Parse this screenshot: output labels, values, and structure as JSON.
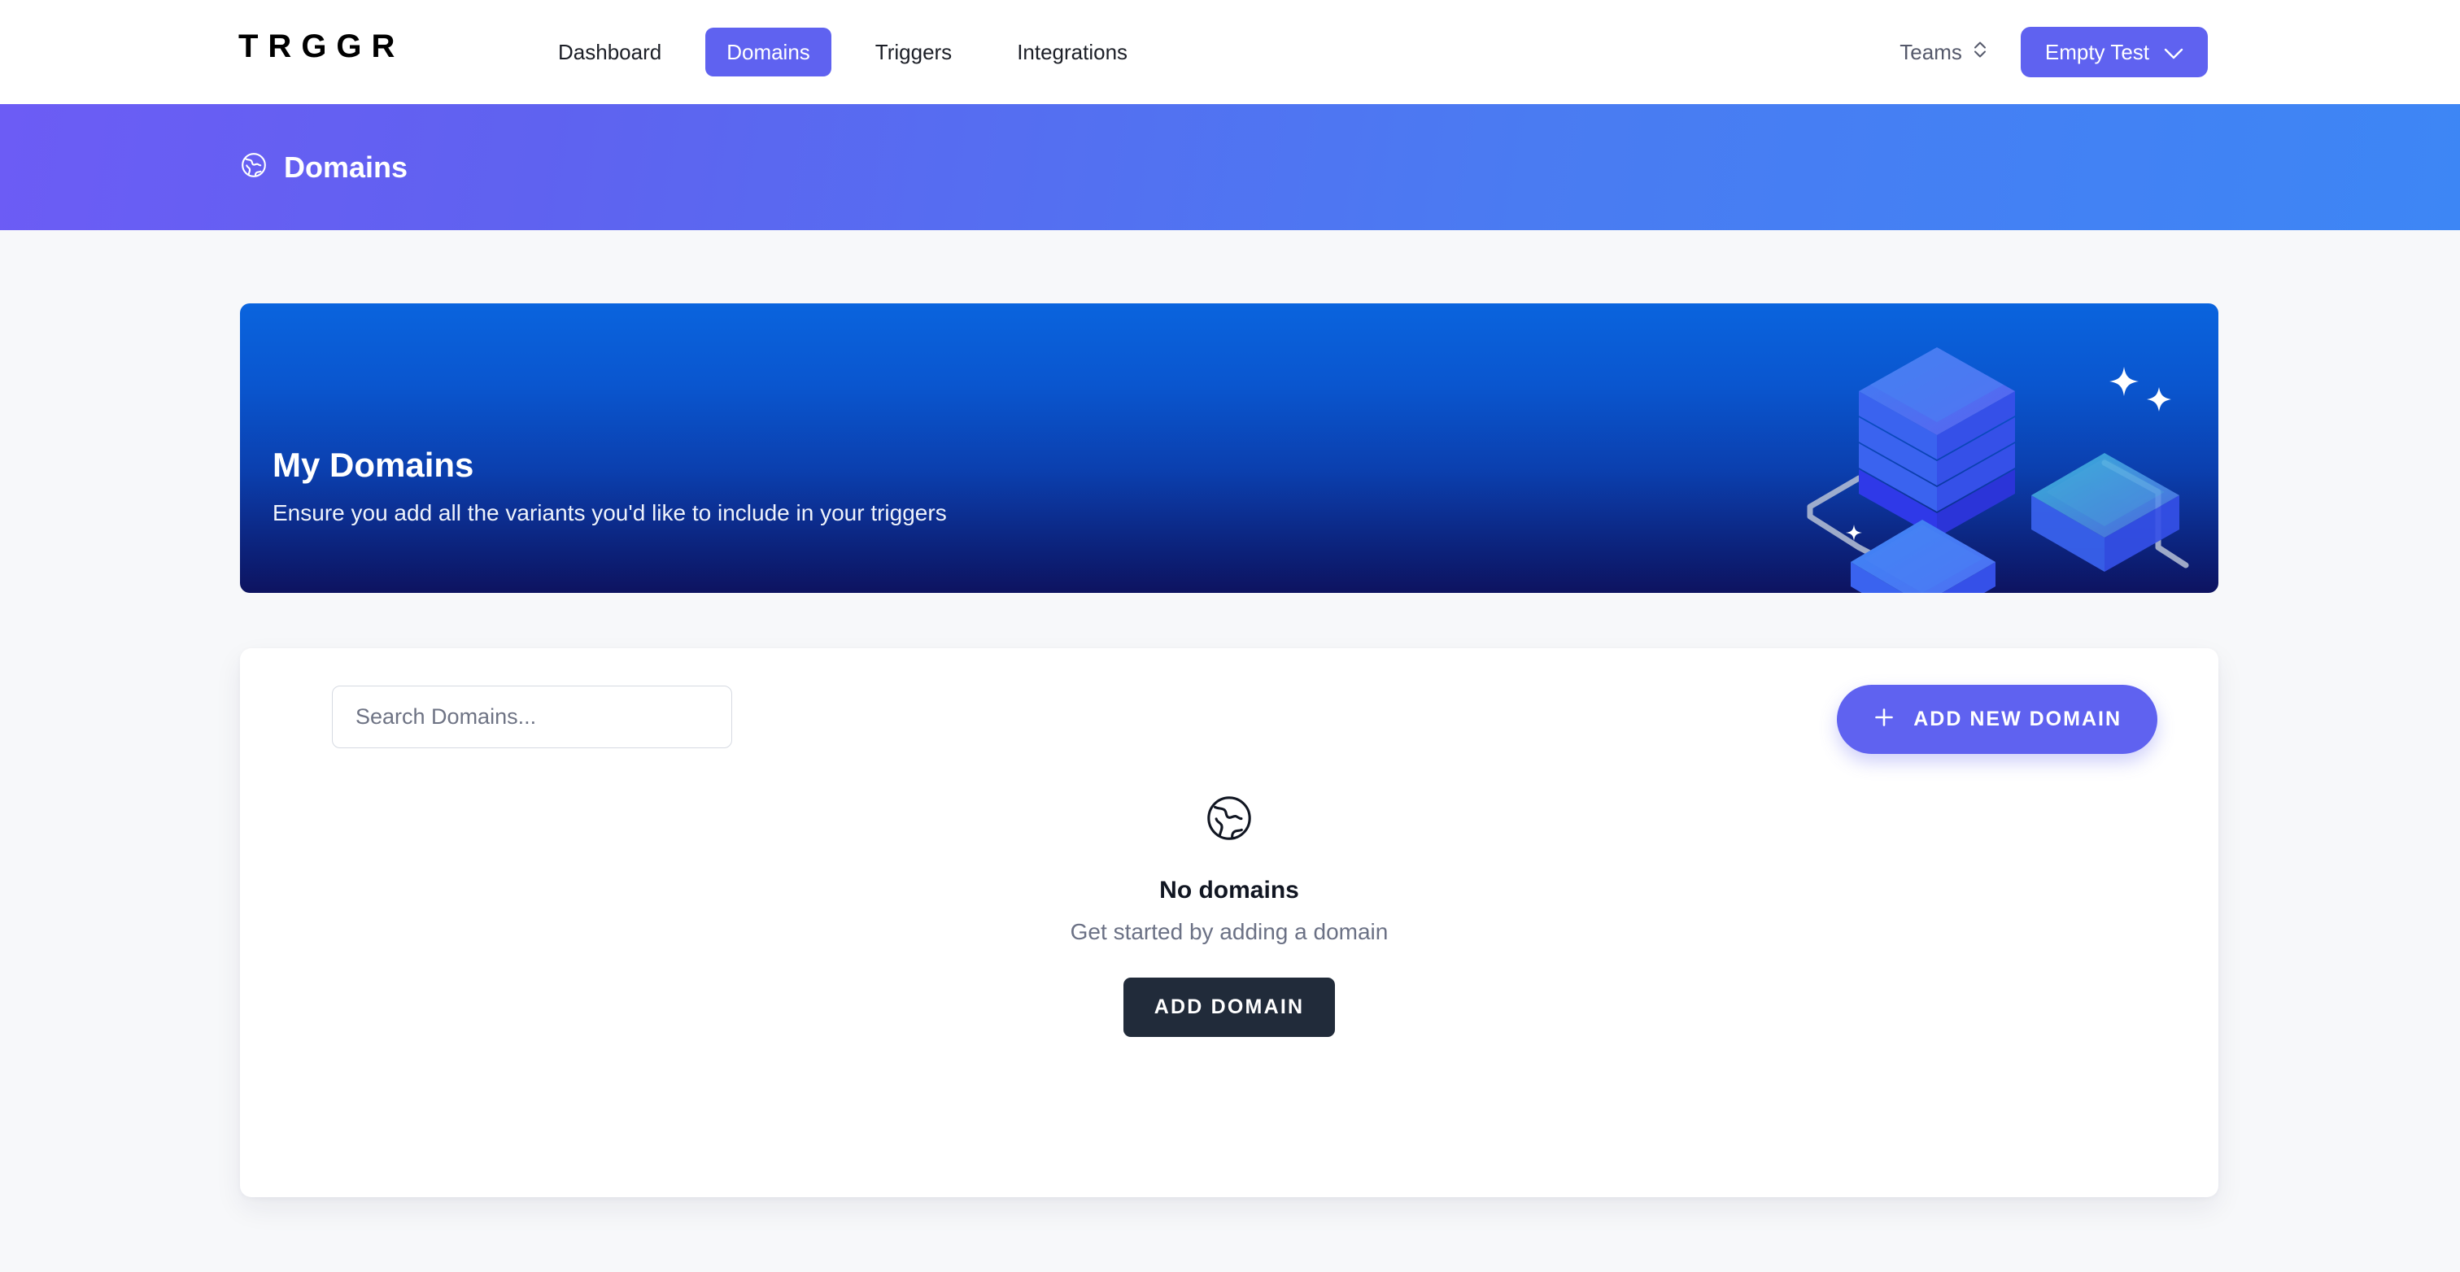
{
  "brand": {
    "logo_text": "TRGGR"
  },
  "nav": {
    "items": [
      {
        "label": "Dashboard",
        "active": false
      },
      {
        "label": "Domains",
        "active": true
      },
      {
        "label": "Triggers",
        "active": false
      },
      {
        "label": "Integrations",
        "active": false
      }
    ],
    "teams_label": "Teams",
    "team_button_label": "Empty Test",
    "icons": {
      "teams_selector": "up-down-chevron-icon",
      "team_dropdown": "chevron-down-icon"
    }
  },
  "page_banner": {
    "title": "Domains",
    "icon": "globe-icon"
  },
  "hero": {
    "title": "My Domains",
    "subtitle": "Ensure you add all the variants you'd like to include in your triggers",
    "illustration": "isometric-database-stack-illustration"
  },
  "search": {
    "placeholder": "Search Domains...",
    "value": ""
  },
  "actions": {
    "add_new_domain_label": "ADD NEW DOMAIN",
    "add_new_domain_icon": "plus-icon",
    "add_domain_label": "ADD DOMAIN"
  },
  "empty_state": {
    "icon": "globe-icon",
    "title": "No domains",
    "subtitle": "Get started by adding a domain"
  },
  "colors": {
    "accent_purple": "#5f62f0",
    "banner_gradient_start": "#6c5cf5",
    "banner_gradient_end": "#3d86f5",
    "hero_gradient_start": "#0a64de",
    "hero_gradient_end": "#0d1360",
    "dark_button": "#212b3a",
    "page_background": "#f7f8fa"
  }
}
